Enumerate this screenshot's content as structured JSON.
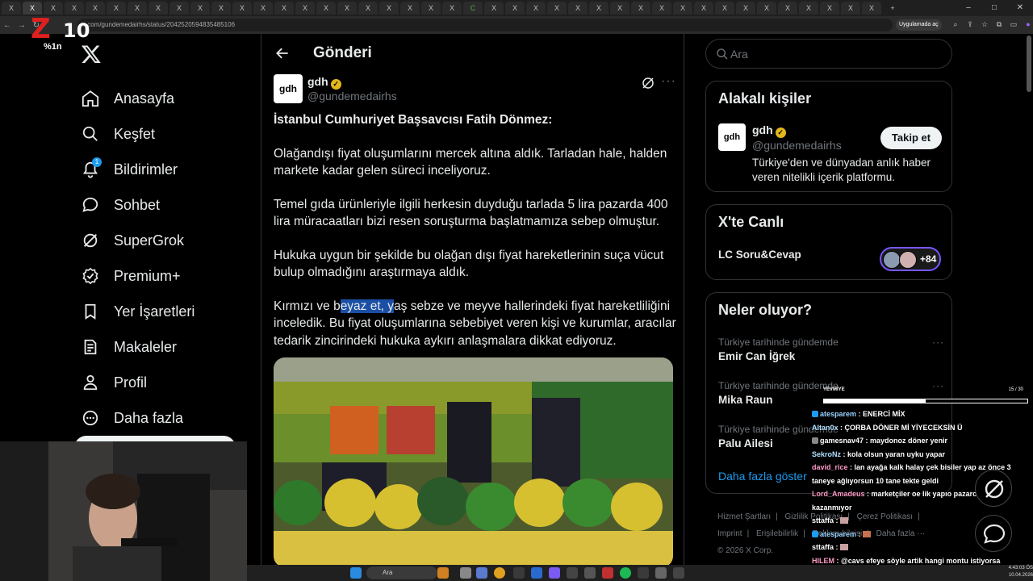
{
  "browser": {
    "url": "x.com/gundemedairhs/status/2042520594835485106",
    "app_pill": "Uygulamada aç",
    "tab_letters": [
      "X",
      "C"
    ],
    "window_controls": [
      "–",
      "□",
      "✕"
    ]
  },
  "stream_logo": {
    "brand": "Z10",
    "sub": "%1n"
  },
  "sidebar": {
    "items": [
      {
        "label": "Anasayfa",
        "icon": "home-icon"
      },
      {
        "label": "Keşfet",
        "icon": "search-icon"
      },
      {
        "label": "Bildirimler",
        "icon": "bell-icon",
        "badge": "1"
      },
      {
        "label": "Sohbet",
        "icon": "chat-bubble-icon"
      },
      {
        "label": "SuperGrok",
        "icon": "grok-icon"
      },
      {
        "label": "Premium+",
        "icon": "verified-badge-icon"
      },
      {
        "label": "Yer İşaretleri",
        "icon": "bookmark-icon"
      },
      {
        "label": "Makaleler",
        "icon": "article-icon"
      },
      {
        "label": "Profil",
        "icon": "person-icon"
      },
      {
        "label": "Daha fazla",
        "icon": "more-circle-icon"
      }
    ]
  },
  "main": {
    "header_title": "Gönderi",
    "author": {
      "name": "gdh",
      "handle": "@gundemedairhs",
      "avatar_text": "gdh"
    },
    "post": {
      "lead": "İstanbul Cumhuriyet Başsavcısı Fatih Dönmez:",
      "p1": "Olağandışı fiyat oluşumlarını mercek altına aldık. Tarladan hale, halden markete kadar gelen süreci inceliyoruz.",
      "p2": "Temel gıda ürünleriyle ilgili herkesin duyduğu tarlada 5 lira pazarda 400 lira müracaatları bizi resen soruşturma başlatmamıza sebep olmuştur.",
      "p3": "Hukuka uygun bir şekilde bu olağan dışı fiyat hareketlerinin suça vücut bulup olmadığını araştırmaya aldık.",
      "p4_before": "Kırmızı ve b",
      "p4_highlight": "eyaz et, y",
      "p4_after": "aş sebze ve meyve hallerindeki fiyat hareketliliğini inceledik. Bu fiyat oluşumlarına sebebiyet veren kişi ve kurumlar, aracılar tedarik zincirindeki hukuka aykırı anlaşmalara dikkat ediyoruz."
    }
  },
  "right": {
    "search_placeholder": "Ara",
    "related": {
      "title": "Alakalı kişiler",
      "name": "gdh",
      "handle": "@gundemedairhs",
      "avatar_text": "gdh",
      "bio": "Türkiye'den ve dünyadan anlık haber veren nitelikli içerik platformu.",
      "follow_label": "Takip et"
    },
    "live": {
      "title": "X'te Canlı",
      "space_name": "LC Soru&Cevap",
      "listener_count": "+84"
    },
    "trends": {
      "title": "Neler oluyor?",
      "items": [
        {
          "meta": "Türkiye tarihinde gündemde",
          "name": "Emir Can İğrek"
        },
        {
          "meta": "Türkiye tarihinde gündemde",
          "name": "Mika Raun"
        },
        {
          "meta": "Türkiye tarihinde gündemde",
          "name": "Palu Ailesi"
        }
      ],
      "show_more": "Daha fazla göster"
    },
    "footer": {
      "links": [
        "Hizmet Şartları",
        "Gizlilik Politikası",
        "Çerez Politikası",
        "Imprint",
        "Erişilebilirlik",
        "Reklam bilgisi",
        "Daha fazla ···"
      ],
      "copyright": "© 2026 X Corp."
    }
  },
  "chat_overlay": {
    "header": "YEVMİYE",
    "progress_label": "15 / 30",
    "progress_fraction": 0.5,
    "messages": [
      {
        "user": "atesparem",
        "text": "ENERCİ MİX"
      },
      {
        "user": "Altan0x",
        "text": "ÇORBA DÖNER Mİ YİYECEKSİN Ü"
      },
      {
        "user": "gamesnav47",
        "text": "maydonoz döner yenir"
      },
      {
        "user": "SekroNz",
        "text": "kola olsun yaran uyku yapar"
      },
      {
        "user": "david_rice",
        "text": "lan ayağa kalk halay çek bisiler yap az önce 3 taneye ağlıyorsun 10 tane tekte geldi"
      },
      {
        "user": "Lord_Amadeus",
        "text": "marketçiler oe lik yapıo pazarcılar çok kazanmıyor"
      },
      {
        "user": "sttaffa",
        "text": ""
      },
      {
        "user": "atesparem",
        "text": ""
      },
      {
        "user": "sttaffa",
        "text": ""
      },
      {
        "user": "HILEM",
        "text": "@cavs efeye söyle artik hangi montu istiyorsa göndersin inşadan"
      }
    ]
  },
  "taskbar": {
    "search_placeholder": "Ara",
    "time": "4:43:03 ÖS",
    "date": "10.04.2026"
  },
  "colors": {
    "accent": "#1d9bf0",
    "verified": "#e2b719",
    "highlight": "#1a4fa5",
    "live_ring": "#7856ff",
    "stream_red": "#e02020"
  }
}
